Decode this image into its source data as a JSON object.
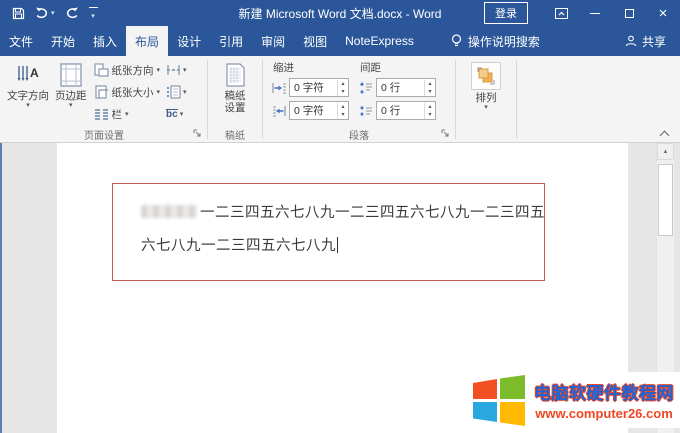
{
  "window": {
    "title": "新建 Microsoft Word 文档.docx - Word",
    "signin": "登录"
  },
  "tabs": [
    {
      "label": "文件"
    },
    {
      "label": "开始"
    },
    {
      "label": "插入"
    },
    {
      "label": "布局"
    },
    {
      "label": "设计"
    },
    {
      "label": "引用"
    },
    {
      "label": "审阅"
    },
    {
      "label": "视图"
    },
    {
      "label": "NoteExpress"
    }
  ],
  "tabbar": {
    "tellme": "操作说明搜索",
    "share": "共享"
  },
  "ribbon": {
    "page_setup": {
      "label": "页面设置",
      "text_direction": "文字方向",
      "margins": "页边距",
      "orientation": "纸张方向",
      "paper_size": "纸张大小",
      "columns": "栏",
      "hyphenation_glyph": "bc"
    },
    "manuscript": {
      "label": "稿纸",
      "button_line1": "稿纸",
      "button_line2": "设置"
    },
    "paragraph": {
      "label": "段落",
      "indent": "缩进",
      "spacing": "间距",
      "indent_left": "0 字符",
      "indent_right": "0 字符",
      "space_before": "0 行",
      "space_after": "0 行"
    },
    "arrange": {
      "label": "排列"
    }
  },
  "document": {
    "line1": "一二三四五六七八九一二三四五六七八九一二三四五",
    "line2": "六七八九一二三四五六七八九"
  },
  "watermark": {
    "site_name": "电脑软硬件教程网",
    "site_url": "www.computer26.com"
  },
  "colors": {
    "titlebar_blue": "#2b579a",
    "red_box_border": "#c45a5a",
    "watermark_blue": "#1c64d8",
    "watermark_red": "#ee4723",
    "win_logo_red": "#f25022",
    "win_logo_green": "#7cbb2a",
    "win_logo_blue": "#29a8e0",
    "win_logo_yellow": "#ffb902",
    "arrange_icon_orange": "#f0b055"
  }
}
